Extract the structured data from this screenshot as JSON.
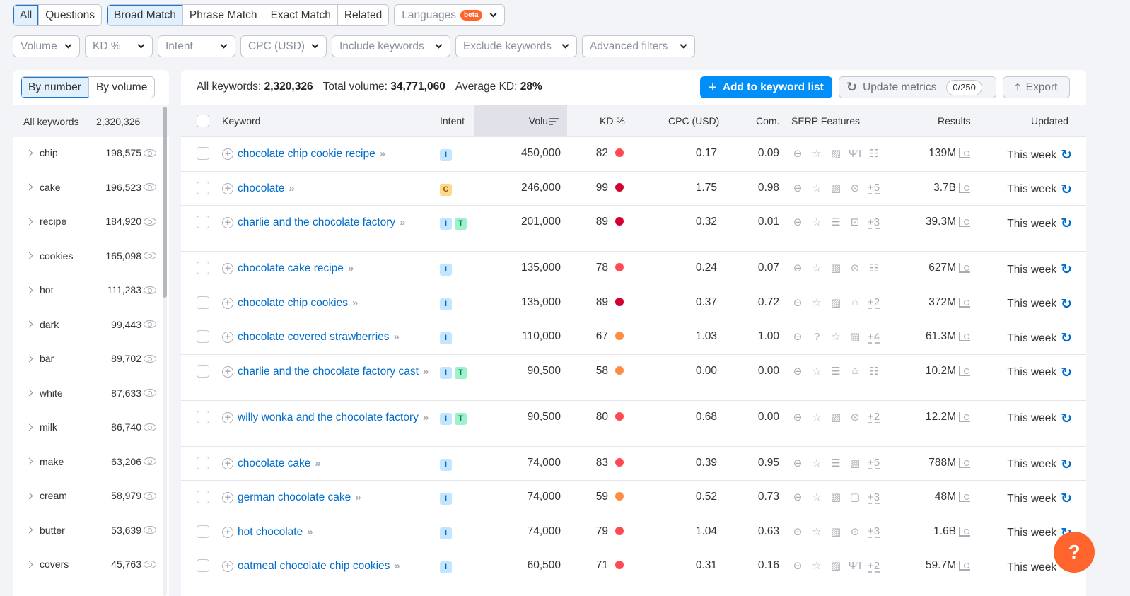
{
  "top_tabs_group1": [
    {
      "label": "All",
      "active": true
    },
    {
      "label": "Questions",
      "active": false
    }
  ],
  "top_tabs_group2": [
    {
      "label": "Broad Match",
      "active": true
    },
    {
      "label": "Phrase Match",
      "active": false
    },
    {
      "label": "Exact Match",
      "active": false
    },
    {
      "label": "Related",
      "active": false
    }
  ],
  "languages": {
    "label": "Languages",
    "badge": "beta"
  },
  "filters": [
    "Volume",
    "KD %",
    "Intent",
    "CPC (USD)",
    "Include keywords",
    "Exclude keywords",
    "Advanced filters"
  ],
  "sidebar": {
    "toggle": [
      {
        "label": "By number",
        "active": true
      },
      {
        "label": "By volume",
        "active": false
      }
    ],
    "all_label": "All keywords",
    "all_count": "2,320,326",
    "items": [
      {
        "word": "chip",
        "count": "198,575"
      },
      {
        "word": "cake",
        "count": "196,523"
      },
      {
        "word": "recipe",
        "count": "184,920"
      },
      {
        "word": "cookies",
        "count": "165,098"
      },
      {
        "word": "hot",
        "count": "111,283"
      },
      {
        "word": "dark",
        "count": "99,443"
      },
      {
        "word": "bar",
        "count": "89,702"
      },
      {
        "word": "white",
        "count": "87,633"
      },
      {
        "word": "milk",
        "count": "86,740"
      },
      {
        "word": "make",
        "count": "63,206"
      },
      {
        "word": "cream",
        "count": "58,979"
      },
      {
        "word": "butter",
        "count": "53,639"
      },
      {
        "word": "covers",
        "count": "45,763"
      }
    ]
  },
  "stats": {
    "all_label": "All keywords:",
    "all_value": "2,320,326",
    "vol_label": "Total volume:",
    "vol_value": "34,771,060",
    "kd_label": "Average KD:",
    "kd_value": "28%"
  },
  "actions": {
    "add": "Add to keyword list",
    "update": "Update metrics",
    "update_count": "0/250",
    "export": "Export"
  },
  "columns": {
    "keyword": "Keyword",
    "intent": "Intent",
    "volume": "Volu",
    "kd": "KD %",
    "cpc": "CPC (USD)",
    "com": "Com.",
    "serp": "SERP Features",
    "results": "Results",
    "updated": "Updated"
  },
  "kd_colors": {
    "very_hard": "#d1002f",
    "hard": "#ff4953",
    "difficult": "#ff8c43"
  },
  "rows": [
    {
      "keyword": "chocolate chip cookie recipe",
      "intent": [
        "I"
      ],
      "volume": "450,000",
      "kd": "82",
      "kd_level": "hard",
      "cpc": "0.17",
      "com": "0.09",
      "serp": [
        "link",
        "star",
        "image",
        "recipe",
        "list"
      ],
      "more": "",
      "results": "139M",
      "updated": "This week",
      "lines": 1
    },
    {
      "keyword": "chocolate",
      "intent": [
        "C"
      ],
      "volume": "246,000",
      "kd": "99",
      "kd_level": "very_hard",
      "cpc": "1.75",
      "com": "0.98",
      "serp": [
        "link",
        "star",
        "image",
        "video"
      ],
      "more": "+5",
      "results": "3.7B",
      "updated": "This week",
      "lines": 1
    },
    {
      "keyword": "charlie and the chocolate factory",
      "intent": [
        "I",
        "T"
      ],
      "volume": "201,000",
      "kd": "89",
      "kd_level": "very_hard",
      "cpc": "0.32",
      "com": "0.01",
      "serp": [
        "link",
        "star",
        "knowledge",
        "carousel"
      ],
      "more": "+3",
      "results": "39.3M",
      "updated": "This week",
      "lines": 2
    },
    {
      "keyword": "chocolate cake recipe",
      "intent": [
        "I"
      ],
      "volume": "135,000",
      "kd": "78",
      "kd_level": "hard",
      "cpc": "0.24",
      "com": "0.07",
      "serp": [
        "link",
        "star",
        "image",
        "video",
        "list"
      ],
      "more": "",
      "results": "627M",
      "updated": "This week",
      "lines": 1
    },
    {
      "keyword": "chocolate chip cookies",
      "intent": [
        "I"
      ],
      "volume": "135,000",
      "kd": "89",
      "kd_level": "very_hard",
      "cpc": "0.37",
      "com": "0.72",
      "serp": [
        "link",
        "star",
        "image",
        "edu"
      ],
      "more": "+2",
      "results": "372M",
      "updated": "This week",
      "lines": 1
    },
    {
      "keyword": "chocolate covered strawberries",
      "intent": [
        "I"
      ],
      "volume": "110,000",
      "kd": "67",
      "kd_level": "difficult",
      "cpc": "1.03",
      "com": "1.00",
      "serp": [
        "link",
        "question",
        "star",
        "image"
      ],
      "more": "+4",
      "results": "61.3M",
      "updated": "This week",
      "lines": 1
    },
    {
      "keyword": "charlie and the chocolate factory cast",
      "intent": [
        "I",
        "T"
      ],
      "volume": "90,500",
      "kd": "58",
      "kd_level": "difficult",
      "cpc": "0.00",
      "com": "0.00",
      "serp": [
        "link",
        "star",
        "knowledge",
        "edu",
        "list"
      ],
      "more": "",
      "results": "10.2M",
      "updated": "This week",
      "lines": 2
    },
    {
      "keyword": "willy wonka and the chocolate factory",
      "intent": [
        "I",
        "T"
      ],
      "volume": "90,500",
      "kd": "80",
      "kd_level": "hard",
      "cpc": "0.68",
      "com": "0.00",
      "serp": [
        "link",
        "star",
        "image",
        "video"
      ],
      "more": "+2",
      "results": "12.2M",
      "updated": "This week",
      "lines": 2
    },
    {
      "keyword": "chocolate cake",
      "intent": [
        "I"
      ],
      "volume": "74,000",
      "kd": "83",
      "kd_level": "hard",
      "cpc": "0.39",
      "com": "0.95",
      "serp": [
        "link",
        "star",
        "knowledge",
        "image"
      ],
      "more": "+5",
      "results": "788M",
      "updated": "This week",
      "lines": 1
    },
    {
      "keyword": "german chocolate cake",
      "intent": [
        "I"
      ],
      "volume": "74,000",
      "kd": "59",
      "kd_level": "difficult",
      "cpc": "0.52",
      "com": "0.73",
      "serp": [
        "link",
        "star",
        "image",
        "faq"
      ],
      "more": "+3",
      "results": "48M",
      "updated": "This week",
      "lines": 1
    },
    {
      "keyword": "hot chocolate",
      "intent": [
        "I"
      ],
      "volume": "74,000",
      "kd": "79",
      "kd_level": "hard",
      "cpc": "1.04",
      "com": "0.63",
      "serp": [
        "link",
        "star",
        "image",
        "video"
      ],
      "more": "+3",
      "results": "1.6B",
      "updated": "This week",
      "lines": 1
    },
    {
      "keyword": "oatmeal chocolate chip cookies",
      "intent": [
        "I"
      ],
      "volume": "60,500",
      "kd": "71",
      "kd_level": "hard",
      "cpc": "0.31",
      "com": "0.16",
      "serp": [
        "link",
        "star",
        "image",
        "recipe"
      ],
      "more": "+2",
      "results": "59.7M",
      "updated": "This week",
      "lines": 1
    }
  ],
  "help_label": "?"
}
